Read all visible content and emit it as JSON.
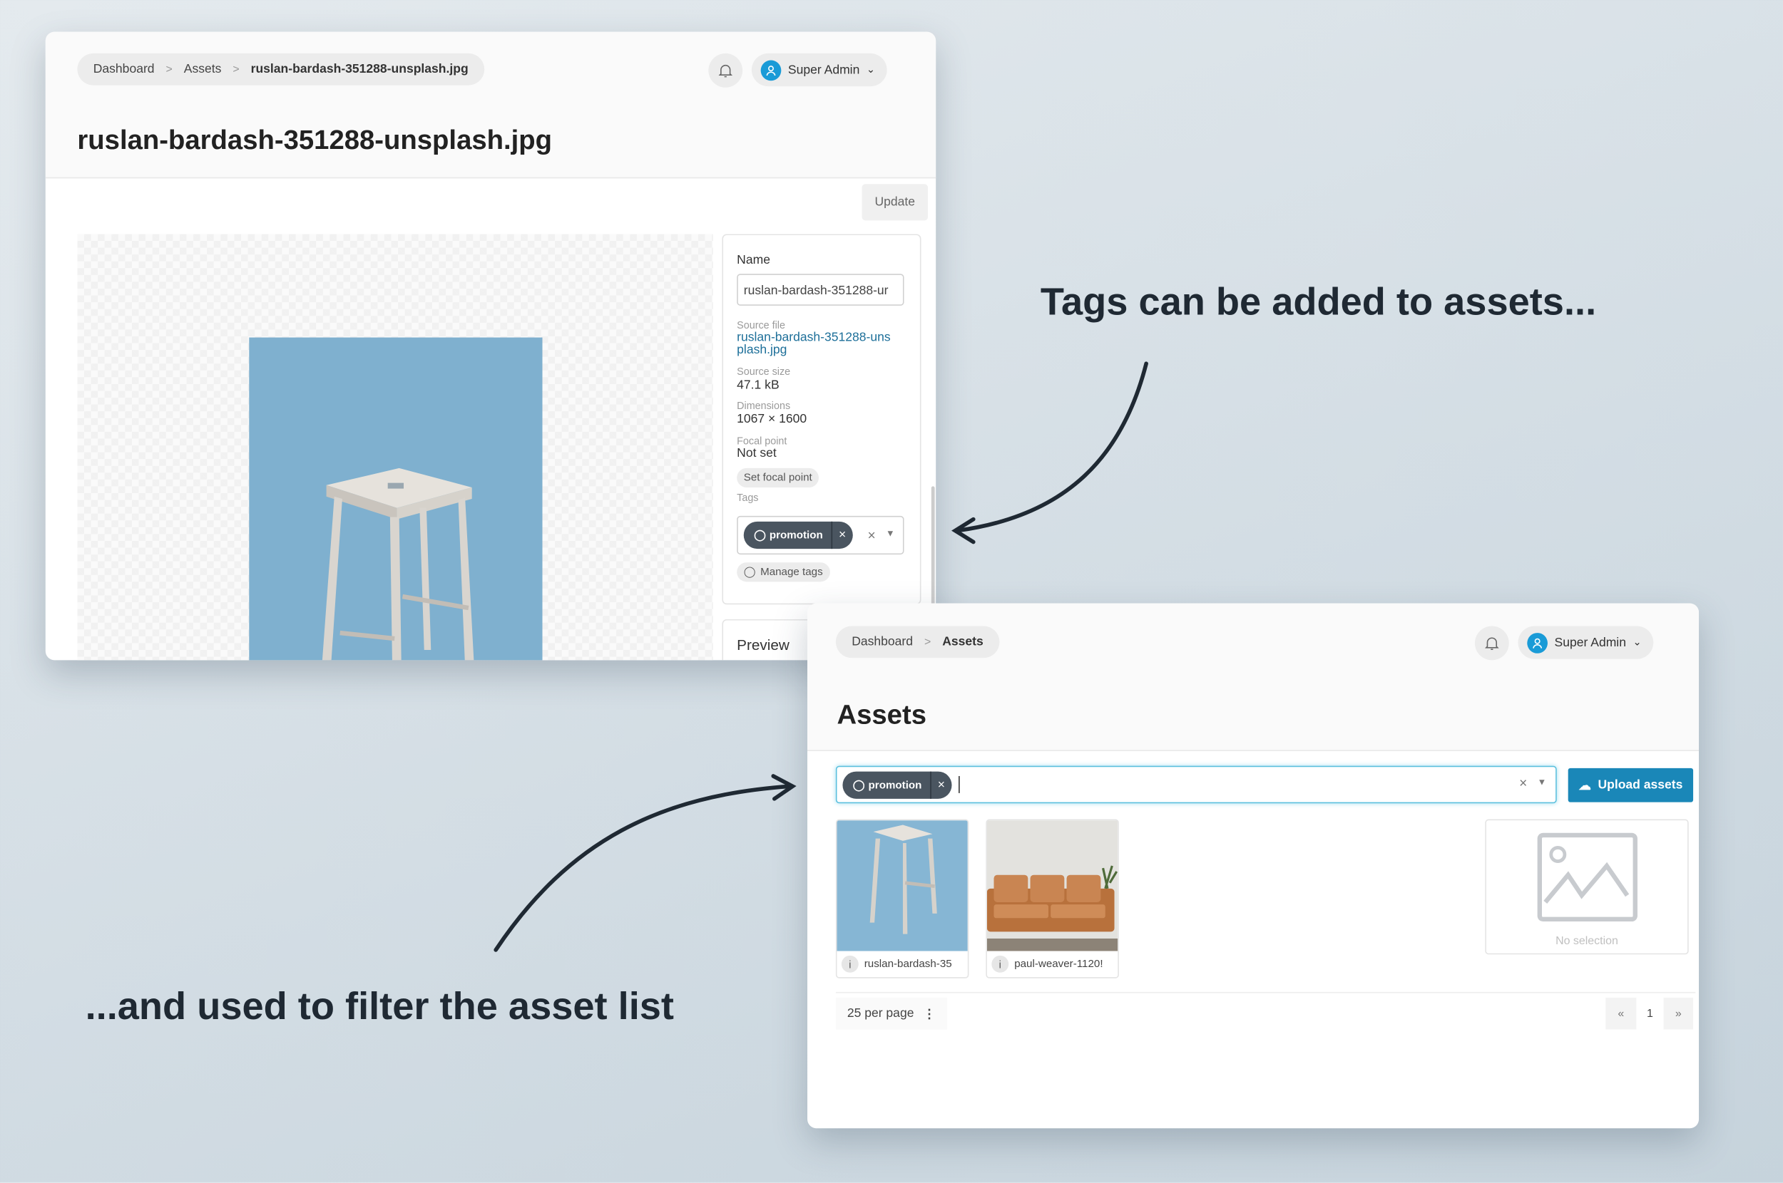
{
  "annotations": {
    "top": "Tags can be added to assets...",
    "bottom": "...and used to filter the asset list"
  },
  "detail_window": {
    "breadcrumb": [
      "Dashboard",
      "Assets",
      "ruslan-bardash-351288-unsplash.jpg"
    ],
    "user": "Super Admin",
    "title": "ruslan-bardash-351288-unsplash.jpg",
    "update_label": "Update",
    "name_label": "Name",
    "name_value": "ruslan-bardash-351288-ur",
    "source_file_label": "Source file",
    "source_file_value": "ruslan-bardash-351288-unsplash.jpg",
    "source_size_label": "Source size",
    "source_size_value": "47.1 kB",
    "dimensions_label": "Dimensions",
    "dimensions_value": "1067 × 1600",
    "focal_label": "Focal point",
    "focal_value": "Not set",
    "set_focal_label": "Set focal point",
    "tags_label": "Tags",
    "tags": [
      "promotion"
    ],
    "manage_tags_label": "Manage tags",
    "preview_label": "Preview"
  },
  "list_window": {
    "breadcrumb": [
      "Dashboard",
      "Assets"
    ],
    "user": "Super Admin",
    "title": "Assets",
    "filter_tags": [
      "promotion"
    ],
    "upload_label": "Upload assets",
    "assets": [
      {
        "name": "ruslan-bardash-35"
      },
      {
        "name": "paul-weaver-1120!"
      }
    ],
    "no_selection": "No selection",
    "per_page": "25 per page",
    "pagination": {
      "prev": "«",
      "page": "1",
      "next": "»"
    }
  },
  "colors": {
    "accent": "#1a87b8",
    "chip": "#4a5560",
    "link": "#1d6f99",
    "focus": "#5bc0de"
  }
}
